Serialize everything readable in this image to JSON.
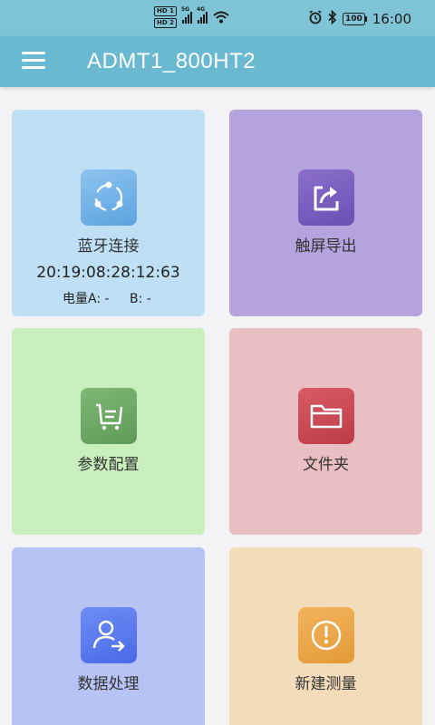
{
  "status_bar": {
    "hd1": "HD 1",
    "hd2": "HD 2",
    "net1": "5G",
    "net2": "4G",
    "battery": "100",
    "time": "16:00",
    "icons": [
      "alarm-icon",
      "bluetooth-icon",
      "wifi-icon",
      "signal-icon"
    ]
  },
  "app_bar": {
    "title": "ADMT1_800HT2",
    "menu_icon": "hamburger-menu-icon",
    "color": "#69b9d0"
  },
  "tiles": [
    {
      "label": "蓝牙连接",
      "icon": "share-nodes-icon",
      "color": "#bfdff5",
      "device_id": "20:19:08:28:12:63",
      "battery_a": "电量A: -",
      "battery_b": "B: -"
    },
    {
      "label": "触屏导出",
      "icon": "export-icon",
      "color": "#b4a3dc"
    },
    {
      "label": "参数配置",
      "icon": "cart-list-icon",
      "color": "#c8efbc"
    },
    {
      "label": "文件夹",
      "icon": "folder-icon",
      "color": "#e9bfc2"
    },
    {
      "label": "数据处理",
      "icon": "user-arrow-icon",
      "color": "#b8c3f5"
    },
    {
      "label": "新建测量",
      "icon": "gauge-icon",
      "color": "#f2dcba"
    }
  ]
}
